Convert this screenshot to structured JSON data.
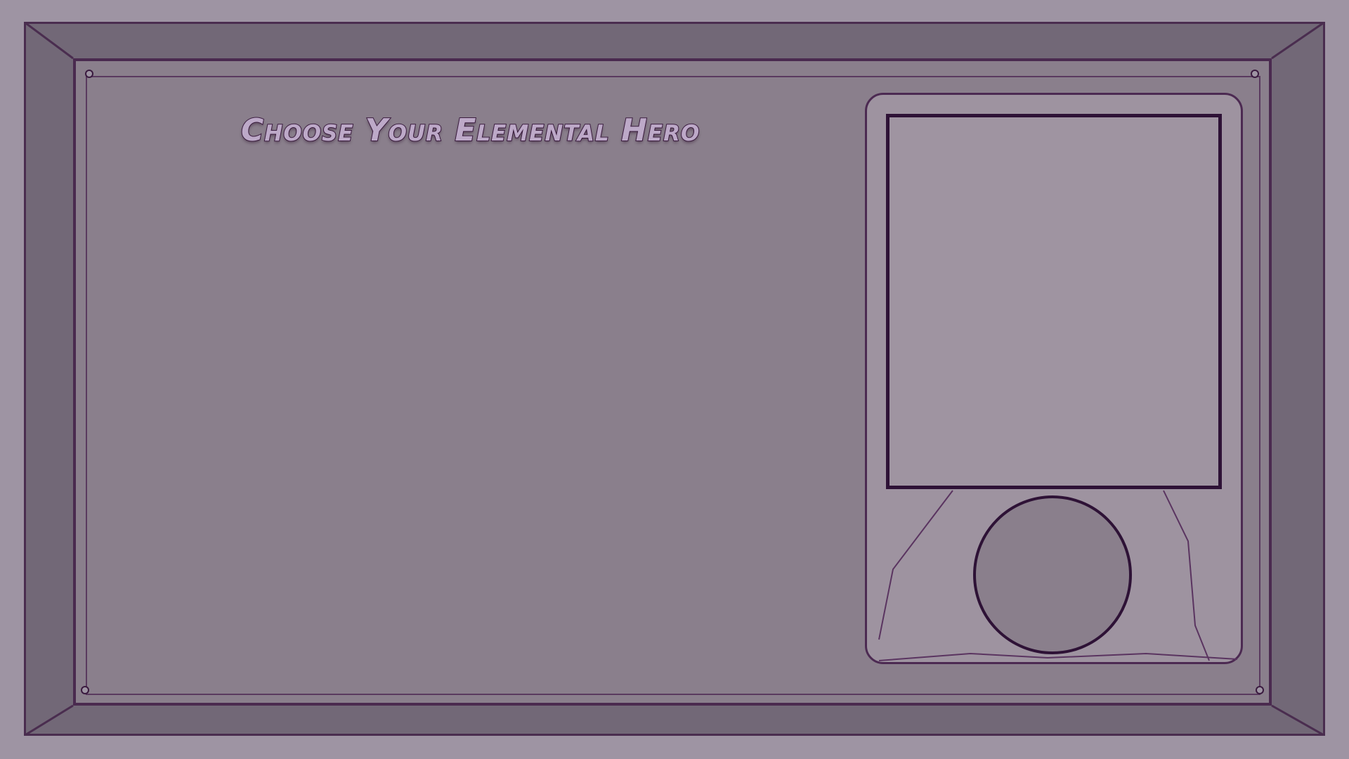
{
  "screen": {
    "title": "Choose Your Elemental Hero"
  },
  "hero_panel": {
    "portrait_state": "empty",
    "emblem_state": "empty"
  },
  "colors": {
    "background": "#9e94a3",
    "frame": "#726877",
    "board": "#8a7f8c",
    "card": "#9e93a0",
    "outline": "#2e1236",
    "title_fill": "#bda9c8"
  }
}
